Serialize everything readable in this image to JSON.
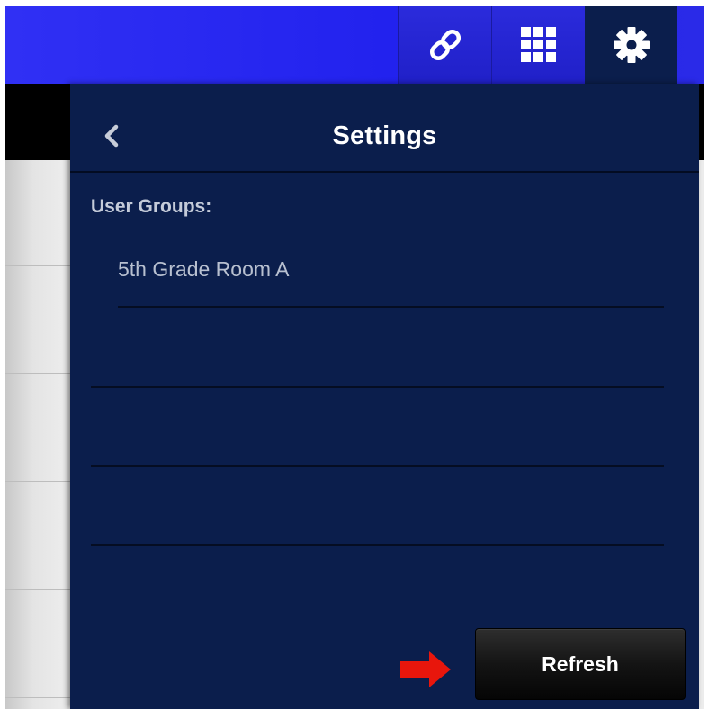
{
  "toolbar": {
    "buttons": [
      {
        "icon": "link-icon"
      },
      {
        "icon": "apps-grid-icon"
      },
      {
        "icon": "gear-icon"
      }
    ],
    "accent_color": "#2222ee"
  },
  "settings_panel": {
    "title": "Settings",
    "back_icon": "chevron-left-icon",
    "section_label": "User Groups:",
    "groups": [
      "5th Grade Room A"
    ],
    "refresh_label": "Refresh",
    "background_color": "#0b1e4c"
  },
  "annotation": {
    "icon": "red-arrow-icon",
    "color": "#e8160c"
  }
}
